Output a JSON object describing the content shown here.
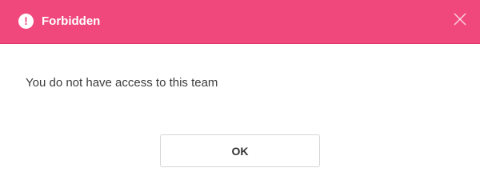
{
  "dialog": {
    "title": "Forbidden",
    "alert_icon": "!",
    "icon_names": {
      "alert": "exclamation-circle-icon",
      "close": "close-icon"
    },
    "message": "You do not have access to this team",
    "ok_label": "OK"
  },
  "colors": {
    "header_background": "#f0487d",
    "header_text": "#ffffff",
    "message_text": "#3b3b3b",
    "button_border": "#d6d6d6"
  }
}
